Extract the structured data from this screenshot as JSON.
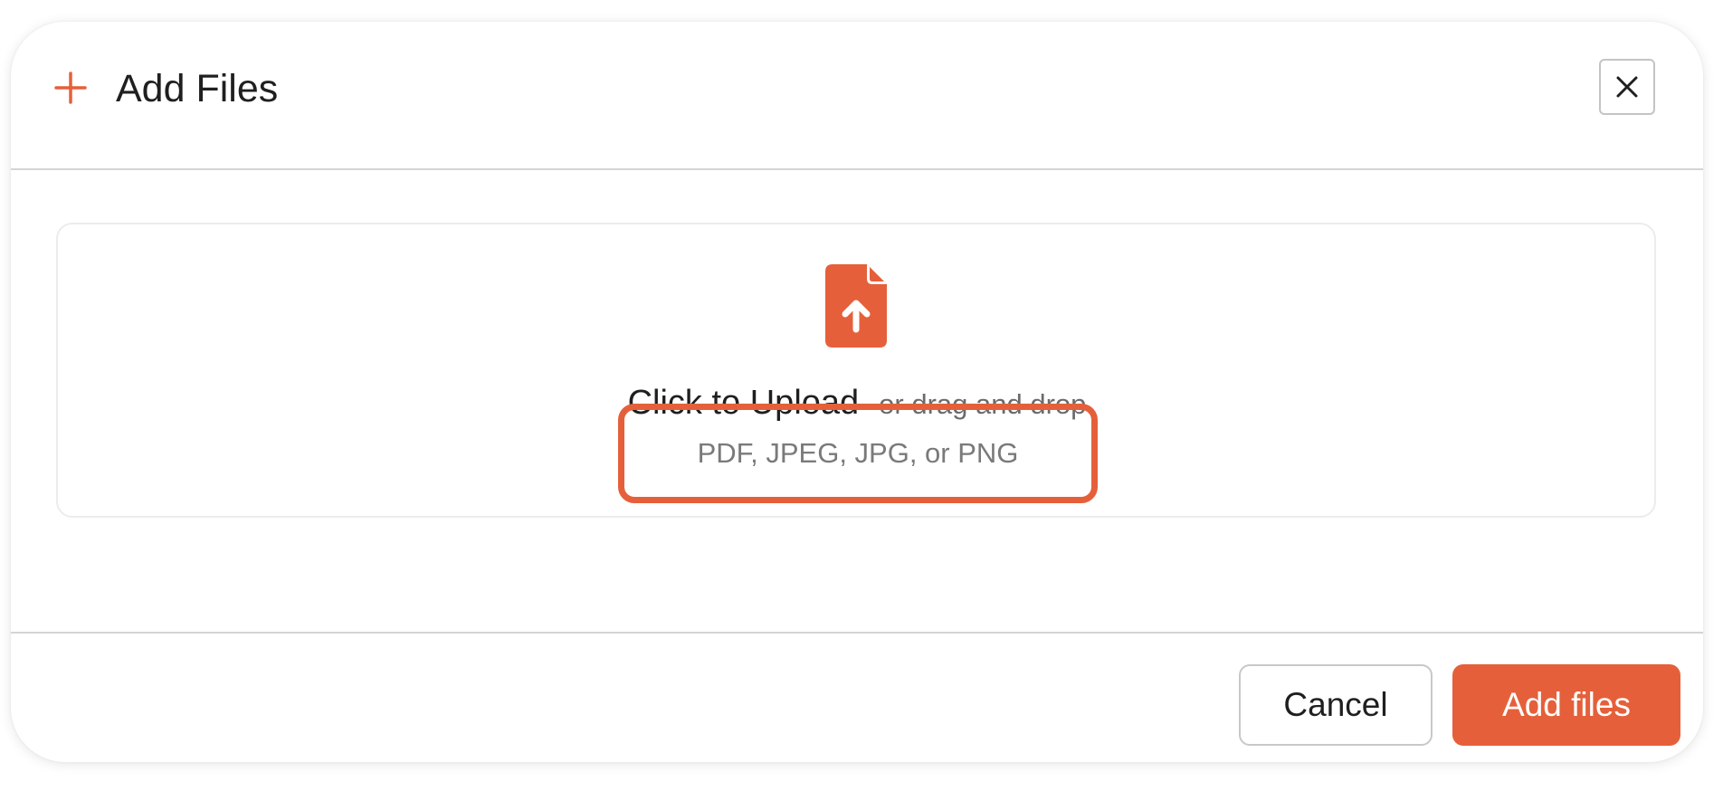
{
  "colors": {
    "accent": "#e5603a",
    "text_primary": "#1f1f1f",
    "text_secondary": "#6b6b6b",
    "divider": "#d4d4d4"
  },
  "header": {
    "icon": "plus-icon",
    "title": "Add Files",
    "close_icon": "close-icon"
  },
  "dropzone": {
    "icon": "file-upload-icon",
    "primary_text": "Click to Upload",
    "secondary_text": "or drag and drop",
    "formats_text": "PDF, JPEG, JPG, or PNG"
  },
  "footer": {
    "cancel_label": "Cancel",
    "submit_label": "Add files"
  }
}
